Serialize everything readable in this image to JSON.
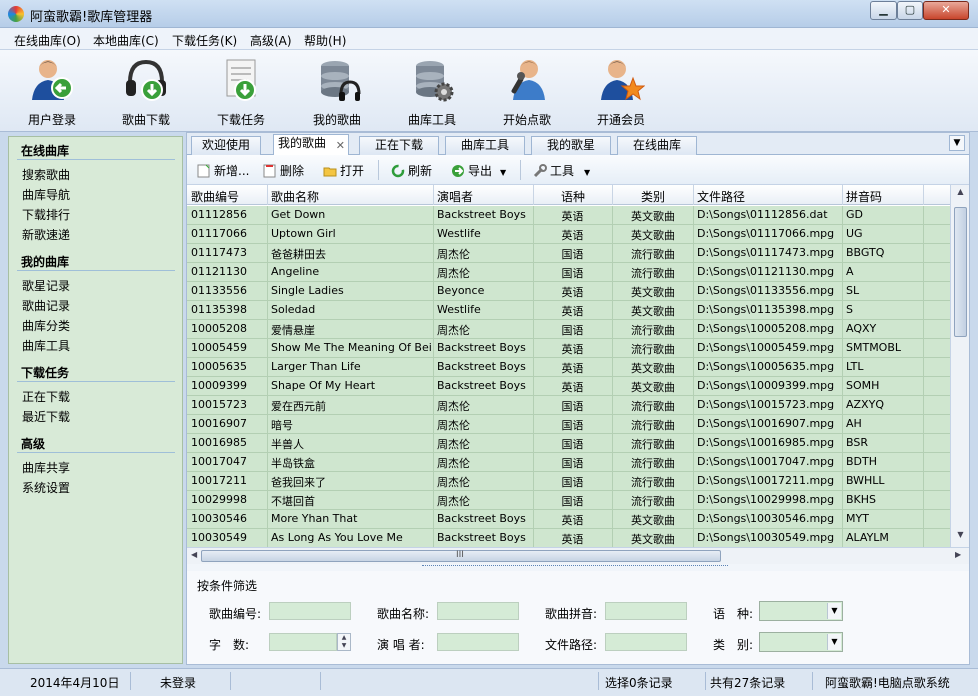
{
  "window": {
    "title": "阿蛮歌霸!歌库管理器",
    "controls": {
      "minimize": "▁",
      "maximize": "▢",
      "close": "✕"
    }
  },
  "menu": [
    "在线曲库(O)",
    "本地曲库(C)",
    "下载任务(K)",
    "高级(A)",
    "帮助(H)"
  ],
  "toolbar": [
    {
      "label": "用户登录",
      "icon": "user-login-icon"
    },
    {
      "label": "歌曲下载",
      "icon": "song-download-icon"
    },
    {
      "label": "下载任务",
      "icon": "download-task-icon"
    },
    {
      "label": "我的歌曲",
      "icon": "my-songs-icon"
    },
    {
      "label": "曲库工具",
      "icon": "library-tools-icon"
    },
    {
      "label": "开始点歌",
      "icon": "start-karaoke-icon"
    },
    {
      "label": "开通会员",
      "icon": "vip-member-icon"
    }
  ],
  "sidebar": {
    "sections": [
      {
        "title": "在线曲库",
        "items": [
          "搜索歌曲",
          "曲库导航",
          "下载排行",
          "新歌速递"
        ]
      },
      {
        "title": "我的曲库",
        "items": [
          "歌星记录",
          "歌曲记录",
          "曲库分类",
          "曲库工具"
        ]
      },
      {
        "title": "下载任务",
        "items": [
          "正在下载",
          "最近下载"
        ]
      },
      {
        "title": "高级",
        "items": [
          "曲库共享",
          "系统设置"
        ]
      }
    ]
  },
  "tabs": [
    {
      "label": "欢迎使用",
      "active": false
    },
    {
      "label": "我的歌曲",
      "active": true,
      "closable": true
    },
    {
      "label": "正在下载",
      "active": false
    },
    {
      "label": "曲库工具",
      "active": false
    },
    {
      "label": "我的歌星",
      "active": false
    },
    {
      "label": "在线曲库",
      "active": false
    }
  ],
  "actions": [
    {
      "label": "新增...",
      "icon": "new-icon"
    },
    {
      "label": "删除",
      "icon": "delete-icon"
    },
    {
      "label": "打开",
      "icon": "open-folder-icon"
    },
    {
      "label": "刷新",
      "icon": "refresh-icon"
    },
    {
      "label": "导出",
      "icon": "export-icon",
      "dropdown": true
    },
    {
      "label": "工具",
      "icon": "tools-icon",
      "dropdown": true
    }
  ],
  "table": {
    "columns": [
      "歌曲编号",
      "歌曲名称",
      "演唱者",
      "语种",
      "类别",
      "文件路径",
      "拼音码"
    ],
    "rows": [
      [
        "01112856",
        "Get Down",
        "Backstreet Boys",
        "英语",
        "英文歌曲",
        "D:\\Songs\\01112856.dat",
        "GD"
      ],
      [
        "01117066",
        "Uptown Girl",
        "Westlife",
        "英语",
        "英文歌曲",
        "D:\\Songs\\01117066.mpg",
        "UG"
      ],
      [
        "01117473",
        "爸爸耕田去",
        "周杰伦",
        "国语",
        "流行歌曲",
        "D:\\Songs\\01117473.mpg",
        "BBGTQ"
      ],
      [
        "01121130",
        "Angeline",
        "周杰伦",
        "国语",
        "流行歌曲",
        "D:\\Songs\\01121130.mpg",
        "A"
      ],
      [
        "01133556",
        "Single Ladies",
        "Beyonce",
        "英语",
        "英文歌曲",
        "D:\\Songs\\01133556.mpg",
        "SL"
      ],
      [
        "01135398",
        "Soledad",
        "Westlife",
        "英语",
        "英文歌曲",
        "D:\\Songs\\01135398.mpg",
        "S"
      ],
      [
        "10005208",
        "爱情悬崖",
        "周杰伦",
        "国语",
        "流行歌曲",
        "D:\\Songs\\10005208.mpg",
        "AQXY"
      ],
      [
        "10005459",
        "Show Me The Meaning Of Being Lonely",
        "Backstreet Boys",
        "英语",
        "流行歌曲",
        "D:\\Songs\\10005459.mpg",
        "SMTMOBL"
      ],
      [
        "10005635",
        "Larger Than Life",
        "Backstreet Boys",
        "英语",
        "英文歌曲",
        "D:\\Songs\\10005635.mpg",
        "LTL"
      ],
      [
        "10009399",
        "Shape Of My Heart",
        "Backstreet Boys",
        "英语",
        "英文歌曲",
        "D:\\Songs\\10009399.mpg",
        "SOMH"
      ],
      [
        "10015723",
        "爱在西元前",
        "周杰伦",
        "国语",
        "流行歌曲",
        "D:\\Songs\\10015723.mpg",
        "AZXYQ"
      ],
      [
        "10016907",
        "暗号",
        "周杰伦",
        "国语",
        "流行歌曲",
        "D:\\Songs\\10016907.mpg",
        "AH"
      ],
      [
        "10016985",
        "半兽人",
        "周杰伦",
        "国语",
        "流行歌曲",
        "D:\\Songs\\10016985.mpg",
        "BSR"
      ],
      [
        "10017047",
        "半岛铁盒",
        "周杰伦",
        "国语",
        "流行歌曲",
        "D:\\Songs\\10017047.mpg",
        "BDTH"
      ],
      [
        "10017211",
        "爸我回来了",
        "周杰伦",
        "国语",
        "流行歌曲",
        "D:\\Songs\\10017211.mpg",
        "BWHLL"
      ],
      [
        "10029998",
        "不堪回首",
        "周杰伦",
        "国语",
        "流行歌曲",
        "D:\\Songs\\10029998.mpg",
        "BKHS"
      ],
      [
        "10030546",
        "More Yhan That",
        "Backstreet Boys",
        "英语",
        "英文歌曲",
        "D:\\Songs\\10030546.mpg",
        "MYT"
      ],
      [
        "10030549",
        "As Long As You Love Me",
        "Backstreet Boys",
        "英语",
        "英文歌曲",
        "D:\\Songs\\10030549.mpg",
        "ALAYLM"
      ]
    ],
    "hscroll_grip": "III"
  },
  "filter": {
    "title": "按条件筛选",
    "fields": [
      {
        "label": "歌曲编号:",
        "value": ""
      },
      {
        "label": "歌曲名称:",
        "value": ""
      },
      {
        "label": "歌曲拼音:",
        "value": ""
      },
      {
        "label": "语　种:",
        "value": "",
        "type": "select"
      },
      {
        "label": "字　数:",
        "value": "",
        "type": "spin"
      },
      {
        "label": "演 唱 者:",
        "value": ""
      },
      {
        "label": "文件路径:",
        "value": ""
      },
      {
        "label": "类　别:",
        "value": "",
        "type": "select"
      }
    ]
  },
  "status": {
    "date": "2014年4月10日",
    "login": "未登录",
    "selected": "选择0条记录",
    "total": "共有27条记录",
    "brand": "阿蛮歌霸!电脑点歌系统"
  },
  "colors": {
    "row_bg": "#cfe6cf",
    "sidebar_bg": "#d8ead7",
    "accent": "#2f6fb5"
  }
}
